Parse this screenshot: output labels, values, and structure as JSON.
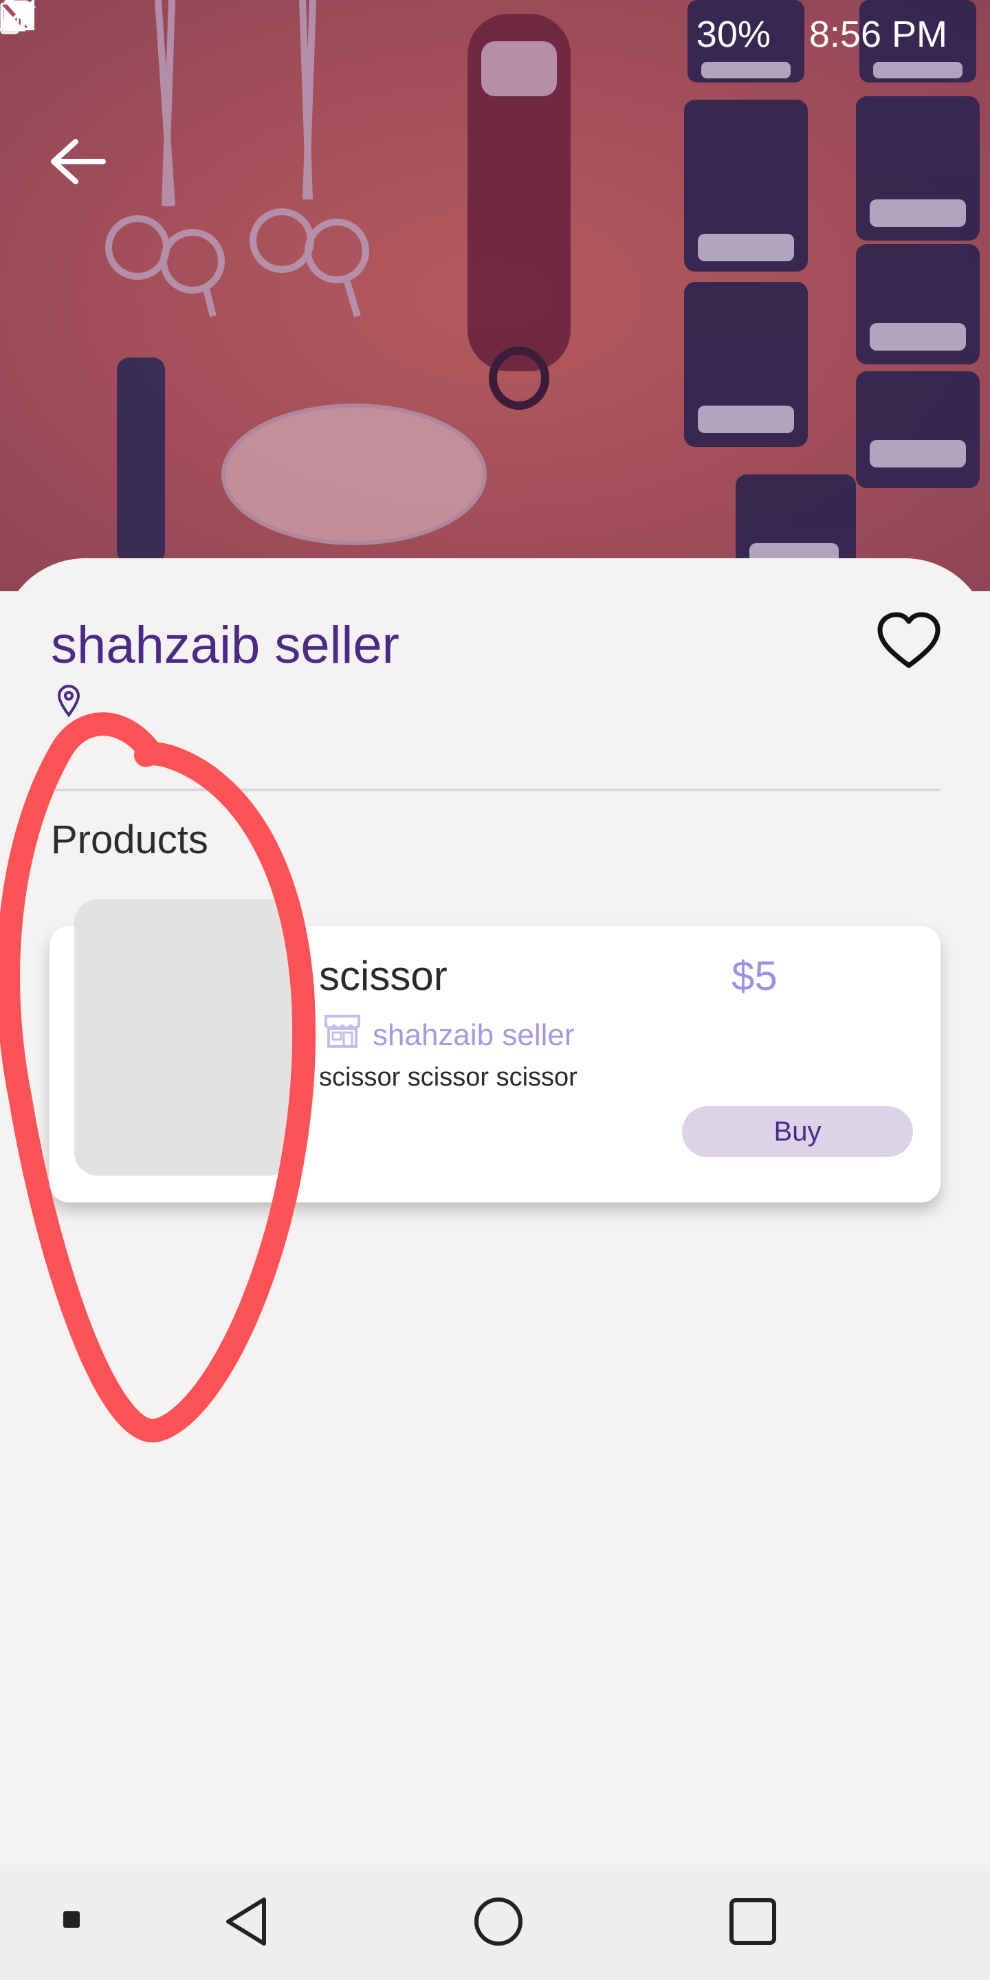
{
  "status_bar": {
    "battery_percent": "30%",
    "time": "8:56 PM",
    "icons": [
      "nfc-icon",
      "wifi-icon",
      "no-sim-icon",
      "signal-icon",
      "battery-icon"
    ]
  },
  "header": {
    "back_icon": "arrow-left-icon"
  },
  "seller": {
    "name": "shahzaib seller",
    "location_icon": "location-pin-icon",
    "favorite_icon": "heart-outline-icon"
  },
  "products_section": {
    "title": "Products",
    "items": [
      {
        "name": "scissor",
        "price": "$5",
        "seller": "shahzaib seller",
        "seller_icon": "store-icon",
        "description": "scissor scissor scissor",
        "buy_label": "Buy"
      }
    ]
  },
  "nav_bar": {
    "items": [
      "recent-dot-icon",
      "back-triangle-icon",
      "home-circle-icon",
      "overview-square-icon"
    ]
  },
  "colors": {
    "accent": "#4b2a86",
    "price": "#9c93de",
    "hero_tint": "#a24e59",
    "annotation": "#fe5356"
  }
}
